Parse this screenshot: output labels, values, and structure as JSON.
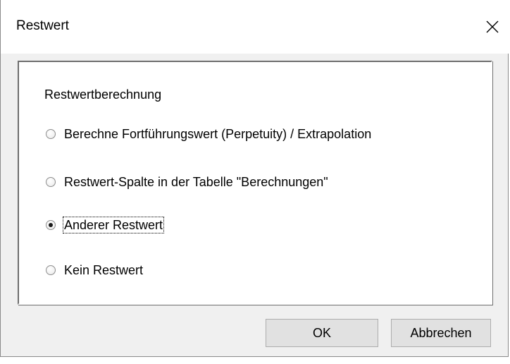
{
  "window": {
    "title": "Restwert",
    "close_icon": "close-icon"
  },
  "group": {
    "label": "Restwertberechnung",
    "options": [
      {
        "label": "Berechne Fortführungswert (Perpetuity) / Extrapolation",
        "checked": false
      },
      {
        "label": "Restwert-Spalte in der Tabelle \"Berechnungen\"",
        "checked": false
      },
      {
        "label": "Anderer Restwert",
        "checked": true
      },
      {
        "label": "Kein Restwert",
        "checked": false
      }
    ]
  },
  "buttons": {
    "ok_label": "OK",
    "cancel_label": "Abbrechen"
  }
}
